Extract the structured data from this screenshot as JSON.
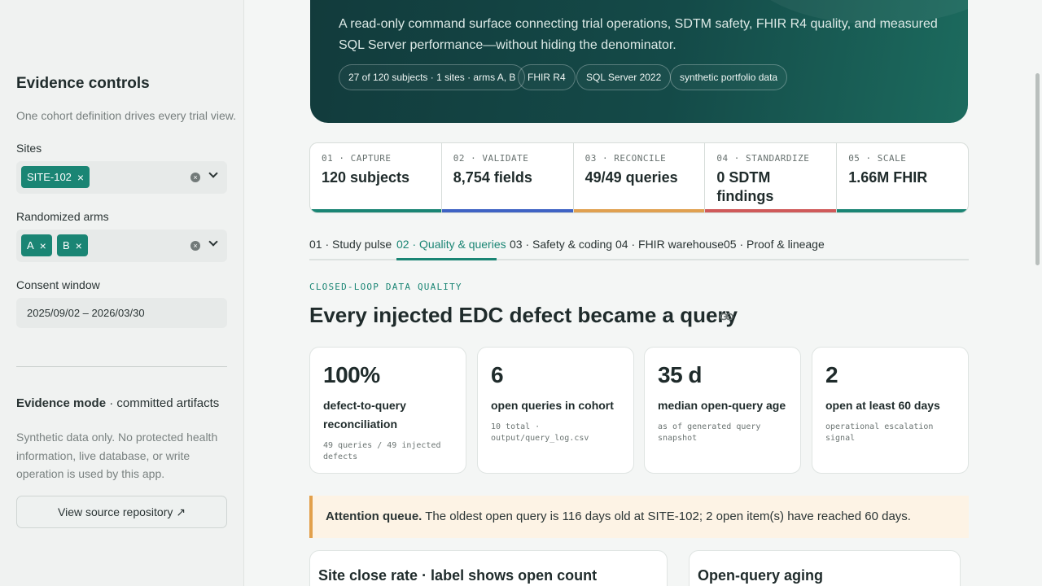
{
  "sidebar": {
    "title": "Evidence controls",
    "subtitle": "One cohort definition drives every trial view.",
    "sites_label": "Sites",
    "sites_selected": [
      "SITE-102"
    ],
    "arms_label": "Randomized arms",
    "arms_selected": [
      "A",
      "B"
    ],
    "consent_label": "Consent window",
    "consent_value": "2025/09/02 – 2026/03/30",
    "mode_title": "Evidence mode",
    "mode_sep": " · ",
    "mode_value": "committed artifacts",
    "note": "Synthetic data only. No protected health information, live database, or write operation is used by this app.",
    "repo_button": "View source repository ↗"
  },
  "hero": {
    "text": "A read-only command surface connecting trial operations, SDTM safety, FHIR R4 quality, and measured SQL Server performance—without hiding the denominator.",
    "pills": [
      "27 of 120 subjects · 1 sites · arms A, B",
      "FHIR R4",
      "SQL Server 2022",
      "synthetic portfolio data"
    ]
  },
  "stages": [
    {
      "key": "01 · CAPTURE",
      "value": "120 subjects",
      "color": "#1a8574"
    },
    {
      "key": "02 · VALIDATE",
      "value": "8,754 fields",
      "color": "#3f63c4"
    },
    {
      "key": "03 · RECONCILE",
      "value": "49/49 queries",
      "color": "#e0a050"
    },
    {
      "key": "04 · STANDARDIZE",
      "value": "0 SDTM findings",
      "color": "#cf5a5a"
    },
    {
      "key": "05 · SCALE",
      "value": "1.66M FHIR",
      "color": "#1a8574"
    }
  ],
  "tabs": [
    "01 · Study pulse",
    "02 · Quality & queries",
    "03 · Safety & coding",
    "04 · FHIR warehouse",
    "05 · Proof & lineage"
  ],
  "active_tab": "02 · Quality & queries",
  "section": {
    "kicker": "CLOSED-LOOP DATA QUALITY",
    "heading": "Every injected EDC defect became a query"
  },
  "kpis": [
    {
      "value": "100%",
      "label": "defect-to-query reconciliation",
      "note": "49 queries / 49 injected defects"
    },
    {
      "value": "6",
      "label": "open queries in cohort",
      "note": "10 total · output/query_log.csv"
    },
    {
      "value": "35 d",
      "label": "median open-query age",
      "note": "as of generated query snapshot"
    },
    {
      "value": "2",
      "label": "open at least 60 days",
      "note": "operational escalation signal"
    }
  ],
  "attention": {
    "title": "Attention queue.",
    "text": " The oldest open query is 116 days old at SITE-102; 2 open item(s) have reached 60 days."
  },
  "panels": [
    {
      "title": "Site close rate · label shows open count"
    },
    {
      "title": "Open-query aging"
    }
  ],
  "colors": {
    "accent": "#1a8574",
    "hero": "#123b3c",
    "attention": "#e2a04b"
  }
}
